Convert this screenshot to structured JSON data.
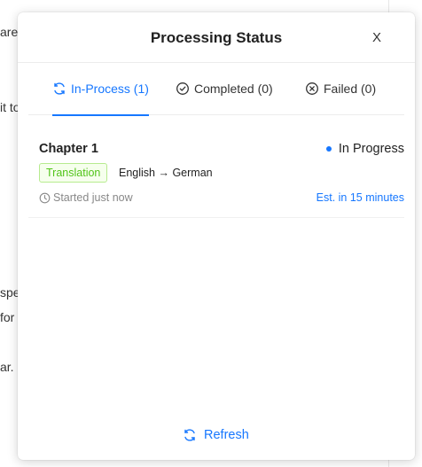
{
  "background": {
    "line_fragments": [
      "are",
      "it to",
      "spe",
      "for",
      "ar. I"
    ]
  },
  "modal": {
    "title": "Processing Status",
    "close_label": "X"
  },
  "tabs": [
    {
      "label": "In-Process (1)",
      "icon": "sync-icon",
      "active": true
    },
    {
      "label": "Completed (0)",
      "icon": "check-circle-icon",
      "active": false
    },
    {
      "label": "Failed (0)",
      "icon": "close-circle-icon",
      "active": false
    }
  ],
  "task": {
    "chapter": "Chapter 1",
    "status": "In Progress",
    "badge": "Translation",
    "languages": "English → German",
    "started": "Started just now",
    "eta": "Est. in 15 minutes"
  },
  "footer": {
    "refresh_label": "Refresh"
  },
  "colors": {
    "accent": "#1677ff",
    "badge_text": "#52c41a",
    "badge_bg": "#f6ffed",
    "badge_border": "#b7eb8f",
    "muted": "#888888"
  }
}
